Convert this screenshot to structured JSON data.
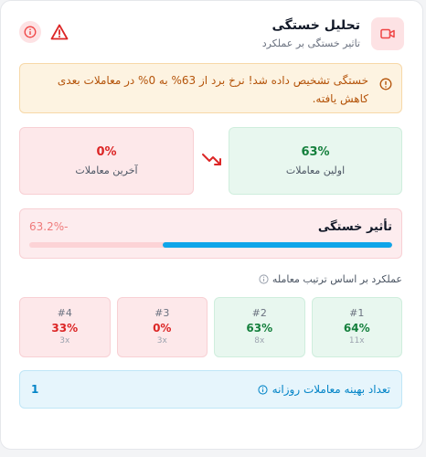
{
  "header": {
    "title": "تحلیل خستگی",
    "subtitle": "تاثیر خستگی بر عملکرد",
    "icon": "video-icon"
  },
  "alert": {
    "message": "خستگی تشخیص داده شد! نرخ برد از 63% به 0% در معاملات بعدی کاهش یافته."
  },
  "compare": {
    "first": {
      "value": "63%",
      "label": "اولین معاملات"
    },
    "last": {
      "value": "0%",
      "label": "آخرین معاملات"
    }
  },
  "impact": {
    "title": "تأثیر خستگی",
    "value": "-63.2%",
    "fill_fraction": 0.632
  },
  "ranks_section": {
    "title": "عملکرد بر اساس ترتیب معامله",
    "items": [
      {
        "num": "#1",
        "value": "64%",
        "count": "11x",
        "status": "good"
      },
      {
        "num": "#2",
        "value": "63%",
        "count": "8x",
        "status": "good"
      },
      {
        "num": "#3",
        "value": "0%",
        "count": "3x",
        "status": "bad"
      },
      {
        "num": "#4",
        "value": "33%",
        "count": "3x",
        "status": "bad"
      }
    ]
  },
  "optimal": {
    "label": "تعداد بهینه معاملات روزانه",
    "value": "1"
  },
  "colors": {
    "green": "#15803d",
    "red": "#dc2626",
    "blue": "#0ea5e9",
    "warning": "#b45309"
  }
}
